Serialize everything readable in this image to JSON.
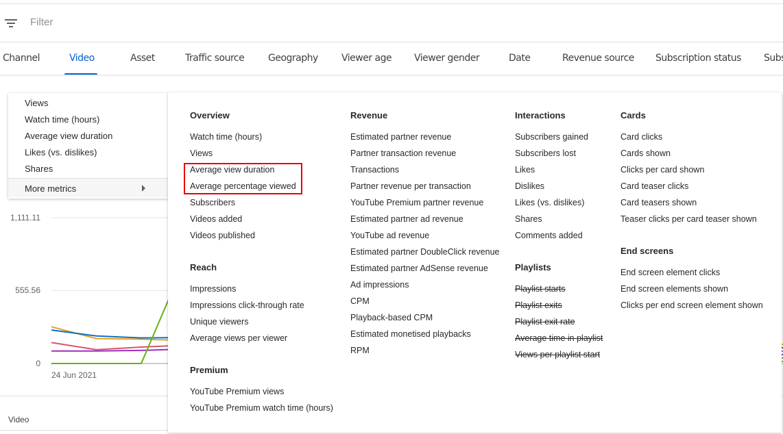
{
  "filter": {
    "icon": "filter-icon",
    "placeholder": "Filter"
  },
  "tabs": [
    {
      "label": "Channel",
      "active": false
    },
    {
      "label": "Video",
      "active": true
    },
    {
      "label": "Asset",
      "active": false
    },
    {
      "label": "Traffic source",
      "active": false
    },
    {
      "label": "Geography",
      "active": false
    },
    {
      "label": "Viewer age",
      "active": false
    },
    {
      "label": "Viewer gender",
      "active": false
    },
    {
      "label": "Date",
      "active": false
    },
    {
      "label": "Revenue source",
      "active": false
    },
    {
      "label": "Subscription status",
      "active": false
    },
    {
      "label": "Subs",
      "active": false
    }
  ],
  "metric_menu": {
    "items": [
      "Views",
      "Watch time (hours)",
      "Average view duration",
      "Likes (vs. dislikes)",
      "Shares"
    ],
    "more_label": "More metrics",
    "more_icon": "arrow-right-icon"
  },
  "more_metrics_panel": {
    "columns": [
      {
        "sections": [
          {
            "title": "Overview",
            "items": [
              {
                "label": "Watch time (hours)",
                "disabled": false
              },
              {
                "label": "Views",
                "disabled": false
              },
              {
                "label": "Average view duration",
                "disabled": false,
                "highlighted": true
              },
              {
                "label": "Average percentage viewed",
                "disabled": false,
                "highlighted": true
              },
              {
                "label": "Subscribers",
                "disabled": false
              },
              {
                "label": "Videos added",
                "disabled": false
              },
              {
                "label": "Videos published",
                "disabled": false
              }
            ]
          },
          {
            "title": "Reach",
            "items": [
              {
                "label": "Impressions",
                "disabled": false
              },
              {
                "label": "Impressions click-through rate",
                "disabled": false
              },
              {
                "label": "Unique viewers",
                "disabled": false
              },
              {
                "label": "Average views per viewer",
                "disabled": false
              }
            ]
          },
          {
            "title": "Premium",
            "items": [
              {
                "label": "YouTube Premium views",
                "disabled": false
              },
              {
                "label": "YouTube Premium watch time (hours)",
                "disabled": false
              }
            ]
          }
        ]
      },
      {
        "sections": [
          {
            "title": "Revenue",
            "items": [
              {
                "label": "Estimated partner revenue",
                "disabled": false
              },
              {
                "label": "Partner transaction revenue",
                "disabled": false
              },
              {
                "label": "Transactions",
                "disabled": false
              },
              {
                "label": "Partner revenue per transaction",
                "disabled": false
              },
              {
                "label": "YouTube Premium partner revenue",
                "disabled": false
              },
              {
                "label": "Estimated partner ad revenue",
                "disabled": false
              },
              {
                "label": "YouTube ad revenue",
                "disabled": false
              },
              {
                "label": "Estimated partner DoubleClick revenue",
                "disabled": false
              },
              {
                "label": "Estimated partner AdSense revenue",
                "disabled": false
              },
              {
                "label": "Ad impressions",
                "disabled": false
              },
              {
                "label": "CPM",
                "disabled": false
              },
              {
                "label": "Playback-based CPM",
                "disabled": false
              },
              {
                "label": "Estimated monetised playbacks",
                "disabled": false
              },
              {
                "label": "RPM",
                "disabled": false
              }
            ]
          }
        ]
      },
      {
        "sections": [
          {
            "title": "Interactions",
            "items": [
              {
                "label": "Subscribers gained",
                "disabled": false
              },
              {
                "label": "Subscribers lost",
                "disabled": false
              },
              {
                "label": "Likes",
                "disabled": false
              },
              {
                "label": "Dislikes",
                "disabled": false
              },
              {
                "label": "Likes (vs. dislikes)",
                "disabled": false
              },
              {
                "label": "Shares",
                "disabled": false
              },
              {
                "label": "Comments added",
                "disabled": false
              }
            ]
          },
          {
            "title": "Playlists",
            "items": [
              {
                "label": "Playlist starts",
                "disabled": true
              },
              {
                "label": "Playlist exits",
                "disabled": true
              },
              {
                "label": "Playlist exit rate",
                "disabled": true
              },
              {
                "label": "Average time in playlist",
                "disabled": true
              },
              {
                "label": "Views per playlist start",
                "disabled": true
              }
            ]
          }
        ]
      },
      {
        "sections": [
          {
            "title": "Cards",
            "items": [
              {
                "label": "Card clicks",
                "disabled": false
              },
              {
                "label": "Cards shown",
                "disabled": false
              },
              {
                "label": "Clicks per card shown",
                "disabled": false
              },
              {
                "label": "Card teaser clicks",
                "disabled": false
              },
              {
                "label": "Card teasers shown",
                "disabled": false
              },
              {
                "label": "Teaser clicks per card teaser shown",
                "disabled": false
              }
            ]
          },
          {
            "title": "End screens",
            "items": [
              {
                "label": "End screen element clicks",
                "disabled": false
              },
              {
                "label": "End screen elements shown",
                "disabled": false
              },
              {
                "label": "Clicks per end screen element shown",
                "disabled": false
              }
            ]
          }
        ]
      }
    ]
  },
  "chart_data": {
    "type": "line",
    "y_ticks": [
      "1,111.11",
      "555.56",
      "0"
    ],
    "ylim": [
      0,
      1111.11
    ],
    "x_start_label": "24 Jun 2021",
    "series": [
      {
        "name": "series-orange",
        "color": "#e8a21c",
        "values": [
          280,
          190,
          185,
          175
        ]
      },
      {
        "name": "series-blue",
        "color": "#0b6fcf",
        "values": [
          255,
          210,
          195,
          198
        ]
      },
      {
        "name": "series-pink",
        "color": "#d9536f",
        "values": [
          160,
          105,
          125,
          140
        ]
      },
      {
        "name": "series-purple",
        "color": "#9c2fc0",
        "values": [
          95,
          95,
          100,
          110
        ]
      },
      {
        "name": "series-green",
        "color": "#66b312",
        "values": [
          0,
          0,
          0,
          800
        ]
      },
      {
        "name": "series-gray",
        "color": "#9e9e9e",
        "values": [
          0,
          0,
          0,
          0
        ]
      }
    ]
  },
  "table": {
    "first_column_header": "Video"
  }
}
